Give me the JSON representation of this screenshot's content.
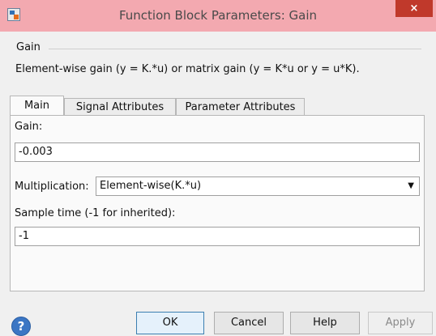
{
  "window": {
    "title": "Function Block Parameters: Gain",
    "close_glyph": "×"
  },
  "block": {
    "name": "Gain",
    "description": "Element-wise gain (y = K.*u) or matrix gain (y = K*u or y = u*K)."
  },
  "tabs": [
    {
      "label": "Main",
      "active": true
    },
    {
      "label": "Signal Attributes",
      "active": false
    },
    {
      "label": "Parameter Attributes",
      "active": false
    }
  ],
  "main": {
    "gain_label": "Gain:",
    "gain_value": "-0.003",
    "multiplication_label": "Multiplication:",
    "multiplication_value": "Element-wise(K.*u)",
    "sample_time_label": "Sample time (-1 for inherited):",
    "sample_time_value": "-1"
  },
  "buttons": {
    "help_glyph": "?",
    "ok": "OK",
    "cancel": "Cancel",
    "help": "Help",
    "apply": "Apply"
  },
  "icons": {
    "app": "simulink-block-icon",
    "close": "close-icon",
    "help": "question-mark-icon",
    "dropdown": "chevron-down-icon"
  },
  "colors": {
    "titlebar": "#f3a9b0",
    "close_button": "#c0392b",
    "help_icon": "#3b76c4"
  }
}
